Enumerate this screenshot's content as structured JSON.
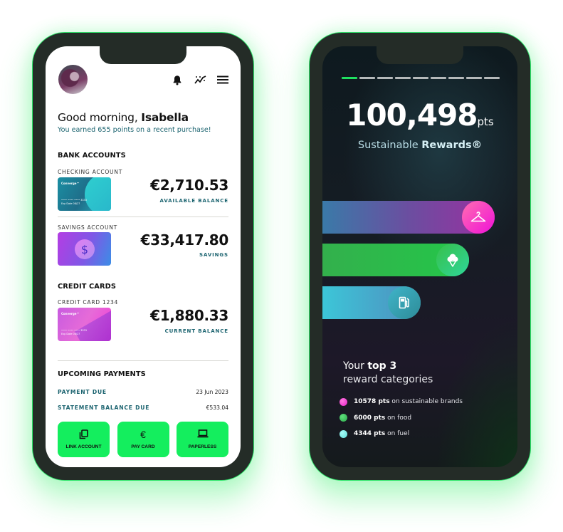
{
  "banking_app": {
    "header": {
      "avatar_alt": "Isabella profile photo",
      "icons": [
        "bell-icon",
        "activity-chart-icon",
        "menu-icon"
      ]
    },
    "greeting": {
      "prefix": "Good morning, ",
      "name": "Isabella",
      "message": "You earned 655 points on a recent purchase!"
    },
    "bank_accounts": {
      "title": "BANK ACCOUNTS",
      "accounts": [
        {
          "label": "CHECKING ACCOUNT",
          "amount": "€2,710.53",
          "amount_label": "AVAILABLE BALANCE",
          "card_brand": "Converge™",
          "card_number": "•••• •••• •••• 3333",
          "card_exp": "Exp Date 08/27"
        },
        {
          "label": "SAVINGS ACCOUNT",
          "amount": "€33,417.80",
          "amount_label": "SAVINGS",
          "card_symbol": "$"
        }
      ]
    },
    "credit_cards": {
      "title": "CREDIT CARDS",
      "cards": [
        {
          "label": "CREDIT CARD 1234",
          "amount": "€1,880.33",
          "amount_label": "CURRENT BALANCE",
          "card_brand": "Converge™",
          "card_number": "•••• •••• •••• 3333",
          "card_exp": "Exp Date 08/27"
        }
      ]
    },
    "upcoming_payments": {
      "title": "UPCOMING PAYMENTS",
      "rows": [
        {
          "key": "PAYMENT DUE",
          "value": "23 Jun 2023"
        },
        {
          "key": "STATEMENT BALANCE DUE",
          "value": "€533.04"
        }
      ]
    },
    "actions": [
      {
        "label": "LINK ACCOUNT",
        "icon": "copy-icon",
        "glyph": "⧉"
      },
      {
        "label": "PAY CARD",
        "icon": "euro-icon",
        "glyph": "€"
      },
      {
        "label": "PAPERLESS",
        "icon": "laptop-icon",
        "glyph": "💻"
      }
    ],
    "colors": {
      "accent_green": "#14ee5e",
      "teal_text": "#1c6470",
      "frame": "#242c27"
    }
  },
  "rewards_app": {
    "progress": {
      "current_step": 1,
      "total_steps": 9
    },
    "points": {
      "value": "100,498",
      "unit": "pts"
    },
    "subtitle": {
      "prefix": "Sustainable ",
      "bold": "Rewards®"
    },
    "bars": [
      {
        "category": "sustainable brands",
        "points": 10578,
        "icon": "hanger-icon"
      },
      {
        "category": "food",
        "points": 6000,
        "icon": "ice-cream-icon"
      },
      {
        "category": "fuel",
        "points": 4344,
        "icon": "fuel-pump-icon"
      }
    ],
    "heading": {
      "line1_prefix": "Your ",
      "line1_bold": "top 3",
      "line2": "reward categories"
    },
    "legend": [
      {
        "bold": "10578 pts",
        "text": " on sustainable brands",
        "color": "#f02fd0"
      },
      {
        "bold": "6000 pts",
        "text": " on food",
        "color": "#2ec55a"
      },
      {
        "bold": "4344 pts",
        "text": " on fuel",
        "color": "#6ee8e4"
      }
    ],
    "colors": {
      "progress_active": "#1fe060",
      "brands": "#f011d8",
      "food": "#2ad04b",
      "fuel": "#3cc6d8"
    }
  }
}
